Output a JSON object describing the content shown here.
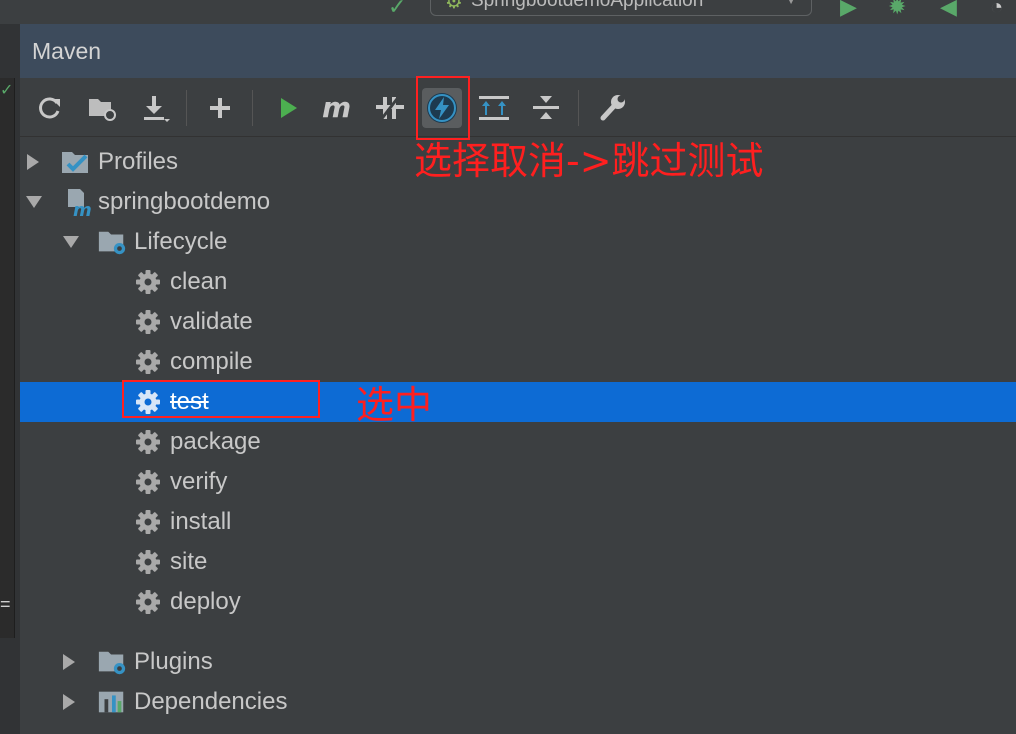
{
  "topbar": {
    "run_config_label": "SpringbootdemoApplication"
  },
  "panel": {
    "title": "Maven"
  },
  "toolbar": {
    "buttons": [
      {
        "name": "reload-icon"
      },
      {
        "name": "generate-sources-icon"
      },
      {
        "name": "download-icon"
      },
      {
        "name": "add-icon"
      },
      {
        "name": "run-icon"
      },
      {
        "name": "execute-goal-icon"
      },
      {
        "name": "toggle-offline-icon"
      },
      {
        "name": "skip-tests-icon",
        "active": true
      },
      {
        "name": "show-dependencies-icon"
      },
      {
        "name": "collapse-all-icon"
      },
      {
        "name": "settings-wrench-icon"
      }
    ]
  },
  "annotations": {
    "toolbar_note": "选择取消->跳过测试",
    "selection_note": "选中"
  },
  "tree": {
    "profiles": "Profiles",
    "project": "springbootdemo",
    "lifecycle": "Lifecycle",
    "phases": [
      "clean",
      "validate",
      "compile",
      "test",
      "package",
      "verify",
      "install",
      "site",
      "deploy"
    ],
    "selected_phase": "test",
    "plugins": "Plugins",
    "dependencies": "Dependencies"
  },
  "colors": {
    "selection": "#0d6bd4",
    "annotation": "#ff1f1f",
    "accent_blue": "#3592c4",
    "run_green": "#59a869"
  }
}
